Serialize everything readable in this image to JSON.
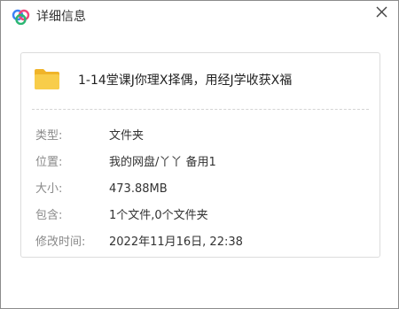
{
  "window": {
    "title": "详细信息",
    "close_icon": "close-icon",
    "logo_icon": "cloud-logo-icon",
    "accent_colors": [
      "#3b82f6",
      "#f0477a",
      "#2bb673"
    ]
  },
  "file": {
    "name": "1-14堂课J你理X择偶，用经J学收获X福",
    "icon": "folder-icon",
    "icon_color": "#f5c342"
  },
  "details": {
    "type_label": "类型:",
    "type_value": "文件夹",
    "location_label": "位置:",
    "location_value": "我的网盘/丫丫 备用1",
    "size_label": "大小:",
    "size_value": "473.88MB",
    "contains_label": "包含:",
    "contains_value": "1个文件,0个文件夹",
    "modified_label": "修改时间:",
    "modified_value": "2022年11月16日, 22:38"
  }
}
